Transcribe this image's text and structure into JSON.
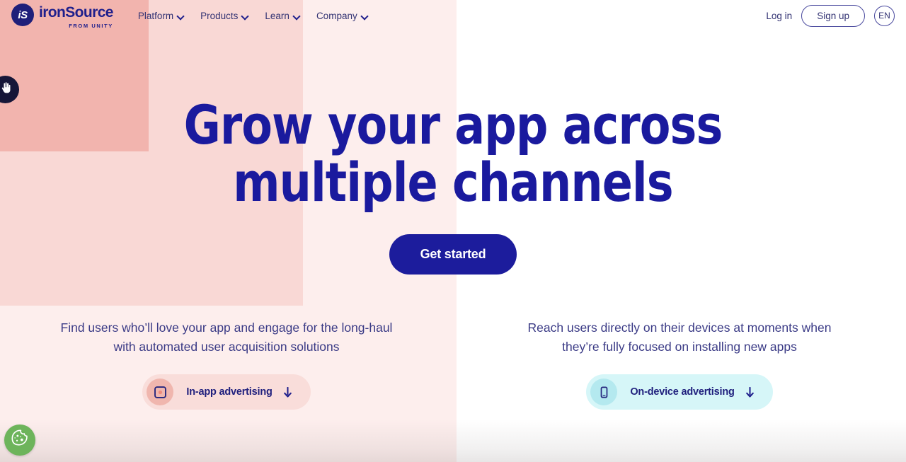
{
  "header": {
    "logo": {
      "mark_text": "iS",
      "name": "ironSource",
      "tagline": "FROM UNITY",
      "mark_color": "#1f1f7a",
      "text_color": "#1f1f8c"
    },
    "nav_items": [
      {
        "label": "Platform",
        "icon": "chevron-down-icon"
      },
      {
        "label": "Products",
        "icon": "chevron-down-icon"
      },
      {
        "label": "Learn",
        "icon": "chevron-down-icon"
      },
      {
        "label": "Company",
        "icon": "chevron-down-icon"
      }
    ],
    "login_label": "Log in",
    "signup_label": "Sign up",
    "language_label": "EN"
  },
  "hero": {
    "title_line_1": "Grow your app across",
    "title_line_2": "multiple channels",
    "cta_label": "Get started",
    "title_color": "#1a1a9e",
    "cta_bg": "#1c1c9c"
  },
  "columns": [
    {
      "description": "Find users who’ll love your app and engage for the long-haul with automated user acquisition solutions",
      "pill_label": "In-app advertising",
      "pill_icon": "app-square-icon",
      "pill_arrow_icon": "arrow-down-icon",
      "pill_bg": "#f9ddda",
      "pill_icon_bg": "#f0b6ae"
    },
    {
      "description": "Reach users directly on their devices at moments when they’re fully focused on installing new apps",
      "pill_label": "On-device advertising",
      "pill_icon": "mobile-phone-icon",
      "pill_arrow_icon": "arrow-down-icon",
      "pill_bg": "#d6f6f8",
      "pill_icon_bg": "#b4e9ef"
    }
  ],
  "widgets": {
    "accessibility_icon": "accessibility-hand-icon",
    "cookie_icon": "cookie-icon",
    "cookie_color": "#6db45b",
    "accessibility_color": "#161638"
  },
  "background": {
    "band_1": "#f2b4ae",
    "band_2": "#f9d8d5",
    "band_3": "#fdeeed",
    "band_4": "#ffffff"
  }
}
